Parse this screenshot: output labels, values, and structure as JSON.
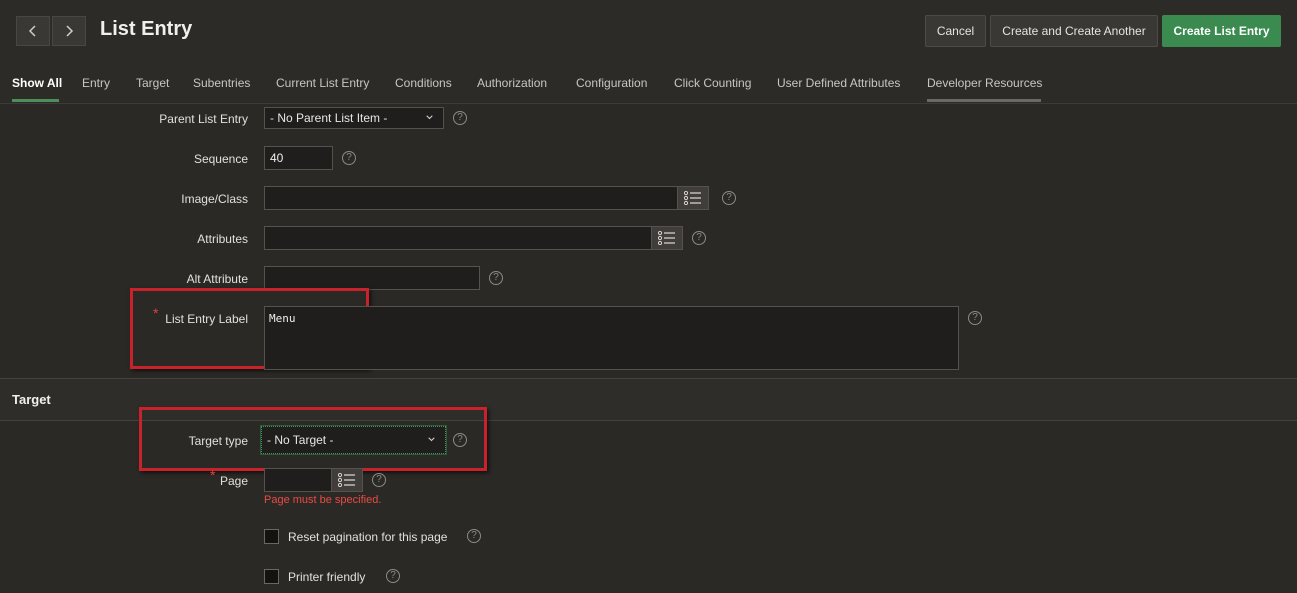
{
  "header": {
    "title": "List Entry",
    "buttons": {
      "cancel": "Cancel",
      "create_another": "Create and Create Another",
      "create": "Create List Entry"
    },
    "prev_icon": "chevron-left-icon",
    "next_icon": "chevron-right-icon"
  },
  "tabs": [
    {
      "label": "Show All"
    },
    {
      "label": "Entry"
    },
    {
      "label": "Target"
    },
    {
      "label": "Subentries"
    },
    {
      "label": "Current List Entry"
    },
    {
      "label": "Conditions"
    },
    {
      "label": "Authorization"
    },
    {
      "label": "Configuration"
    },
    {
      "label": "Click Counting"
    },
    {
      "label": "User Defined Attributes"
    },
    {
      "label": "Developer Resources"
    }
  ],
  "form": {
    "parent_list_entry": {
      "label": "Parent List Entry",
      "value": "- No Parent List Item -"
    },
    "sequence": {
      "label": "Sequence",
      "value": "40"
    },
    "image_class": {
      "label": "Image/Class",
      "value": ""
    },
    "attributes": {
      "label": "Attributes",
      "value": ""
    },
    "alt_attribute": {
      "label": "Alt Attribute",
      "value": ""
    },
    "list_entry_label": {
      "label": "List Entry Label",
      "value": "Menu"
    }
  },
  "target_section": {
    "title": "Target",
    "target_type": {
      "label": "Target type",
      "value": "- No Target -"
    },
    "page": {
      "label": "Page",
      "value": "",
      "error": "Page must be specified."
    },
    "reset_pagination": {
      "label": "Reset pagination for this page"
    },
    "printer_friendly": {
      "label": "Printer friendly"
    }
  },
  "colors": {
    "accent": "#3b8a4f",
    "highlight": "#c8232b",
    "error": "#ea4a44"
  }
}
